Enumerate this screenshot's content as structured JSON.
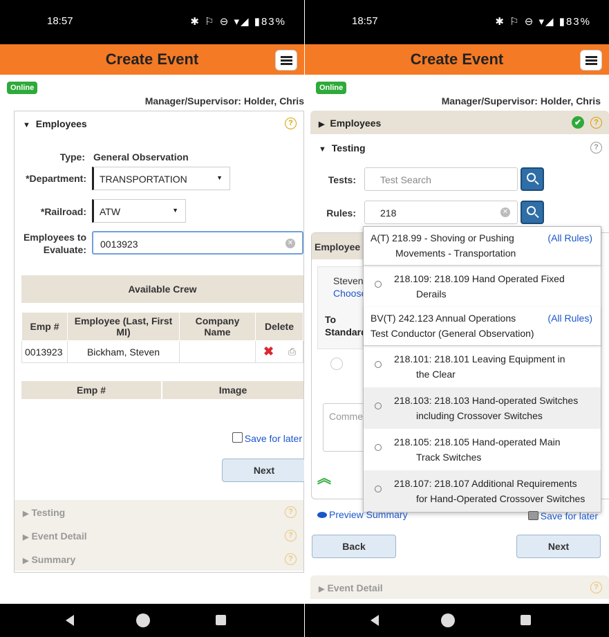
{
  "status": {
    "time": "18:57",
    "icons": "✱ ⚐ ⊖ ▾◢ ▮83%"
  },
  "app": {
    "title": "Create Event",
    "online": "Online",
    "manager": "Manager/Supervisor: Holder, Chris"
  },
  "left": {
    "employees_header": "Employees",
    "type_label": "Type:",
    "type_value": "General Observation",
    "department_label": "*Department:",
    "department_value": "TRANSPORTATION",
    "railroad_label": "*Railroad:",
    "railroad_value": "ATW",
    "evaluate_label_1": "Employees to",
    "evaluate_label_2": "Evaluate:",
    "evaluate_value": "0013923",
    "available_crew": "Available Crew",
    "crew_headers": [
      "Emp #",
      "Employee (Last, First MI)",
      "Company Name",
      "Delete"
    ],
    "crew_rows": [
      {
        "emp": "0013923",
        "name": "Bickham, Steven",
        "company": ""
      }
    ],
    "image_headers": [
      "Emp #",
      "Image"
    ],
    "save_later": "Save for later",
    "next": "Next",
    "collapsed": [
      "Testing",
      "Event Detail",
      "Summary"
    ]
  },
  "right": {
    "employees_header": "Employees",
    "testing_header": "Testing",
    "tests_label": "Tests:",
    "tests_placeholder": "Test Search",
    "rules_label": "Rules:",
    "rules_value": "218",
    "employee_tab": "Employee",
    "employee_name": "Steven",
    "choose": "Choose",
    "to_label": "To",
    "standard_label": "Standard",
    "comment_placeholder": "Comme",
    "preview_summary": "Preview Summary",
    "save_later": "Save for later",
    "back": "Back",
    "next": "Next",
    "event_detail": "Event Detail",
    "dropdown": [
      {
        "kind": "head",
        "line1": "A(T)  218.99 - Shoving or Pushing",
        "line2": "Movements - Transportation",
        "all_rules": "(All Rules)"
      },
      {
        "kind": "item",
        "line1": "218.109:  218.109 Hand Operated Fixed",
        "line2": "Derails",
        "alt": false
      },
      {
        "kind": "head",
        "line1": "BV(T) 242.123 Annual Operations",
        "line2": "Test Conductor (General Observation)",
        "all_rules": "(All Rules)"
      },
      {
        "kind": "item",
        "line1": "218.101:  218.101 Leaving Equipment in",
        "line2": "the Clear",
        "alt": false
      },
      {
        "kind": "item",
        "line1": "218.103:  218.103 Hand-operated Switches",
        "line2": "including Crossover Switches",
        "alt": true
      },
      {
        "kind": "item",
        "line1": "218.105:  218.105 Hand-operated Main",
        "line2": "Track Switches",
        "alt": false
      },
      {
        "kind": "item",
        "line1": "218.107:  218.107 Additional Requirements",
        "line2": "for Hand-Operated Crossover Switches",
        "alt": true
      }
    ]
  },
  "colors": {
    "appbar": "#f47a25",
    "online": "#2eaa3a",
    "link": "#1a56c9",
    "search_button": "#2f6ea6",
    "section_bg": "#e8e1d6"
  }
}
